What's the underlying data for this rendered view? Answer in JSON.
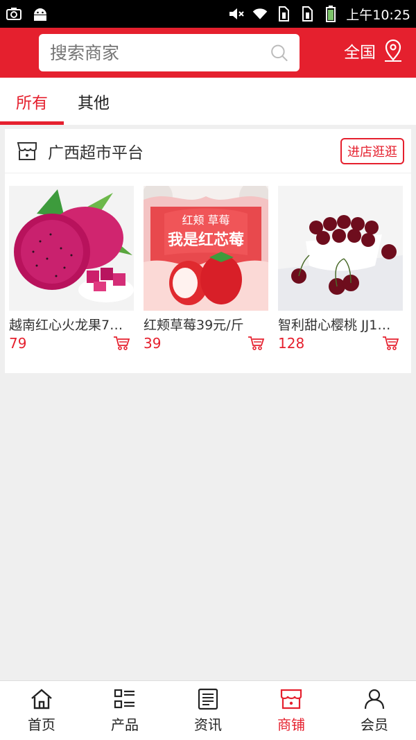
{
  "status_bar": {
    "time": "上午10:25",
    "icons": [
      "screenshot-icon",
      "android-icon",
      "mute-icon",
      "wifi-icon",
      "sim1-icon",
      "sim2-icon",
      "battery-icon"
    ]
  },
  "header": {
    "search_placeholder": "搜索商家",
    "region_label": "全国",
    "accent": "#e5202e"
  },
  "tabs": [
    {
      "label": "所有",
      "active": true
    },
    {
      "label": "其他",
      "active": false
    }
  ],
  "shop": {
    "name": "广西超市平台",
    "enter_label": "进店逛逛",
    "products": [
      {
        "name": "越南红心火龙果7…",
        "price": "79",
        "image": "dragon-fruit"
      },
      {
        "name": "红颊草莓39元/斤",
        "price": "39",
        "image": "strawberry",
        "banner_line1": "红颊 草莓",
        "banner_line2": "我是红芯莓"
      },
      {
        "name": "智利甜心樱桃 JJ1…",
        "price": "128",
        "image": "cherries"
      }
    ]
  },
  "bottom_nav": [
    {
      "label": "首页",
      "icon": "home-icon",
      "active": false
    },
    {
      "label": "产品",
      "icon": "list-icon",
      "active": false
    },
    {
      "label": "资讯",
      "icon": "news-icon",
      "active": false
    },
    {
      "label": "商铺",
      "icon": "store-icon",
      "active": true
    },
    {
      "label": "会员",
      "icon": "user-icon",
      "active": false
    }
  ]
}
